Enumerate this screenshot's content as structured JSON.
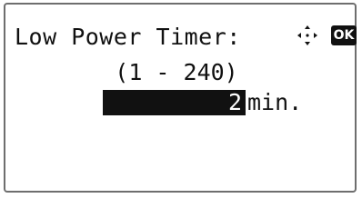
{
  "screen": {
    "title": "Low Power Timer:",
    "range": "(1 - 240)",
    "value": "2",
    "unit": "min.",
    "ok_label": "OK"
  },
  "icons": {
    "navigation": "four-way-arrow-icon",
    "ok": "ok-key-icon"
  },
  "colors": {
    "text": "#111111",
    "background": "#ffffff",
    "highlight": "#111111",
    "border": "#6e6e6e"
  }
}
